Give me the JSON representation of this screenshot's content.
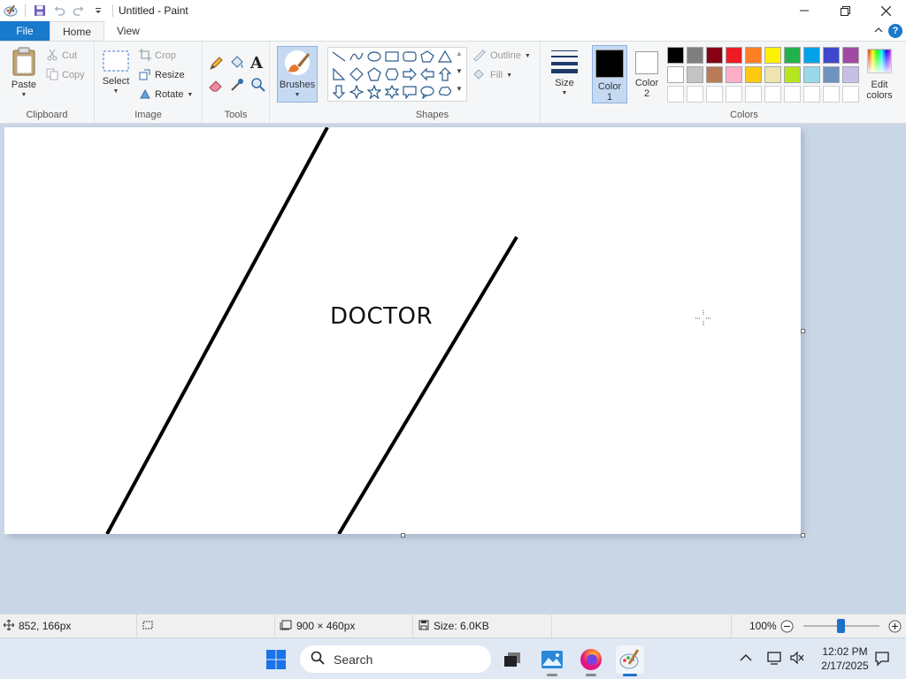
{
  "window": {
    "title": "Untitled - Paint"
  },
  "tabs": {
    "file": "File",
    "home": "Home",
    "view": "View"
  },
  "clipboard": {
    "paste": "Paste",
    "cut": "Cut",
    "copy": "Copy",
    "label": "Clipboard"
  },
  "image": {
    "select": "Select",
    "crop": "Crop",
    "resize": "Resize",
    "rotate": "Rotate",
    "label": "Image"
  },
  "tools": {
    "label": "Tools",
    "text_glyph": "A"
  },
  "brushes": {
    "label": "Brushes"
  },
  "shapes": {
    "outline": "Outline",
    "fill": "Fill",
    "label": "Shapes"
  },
  "size": {
    "label": "Size"
  },
  "colors": {
    "color1_line1": "Color",
    "color1_line2": "1",
    "color2_line1": "Color",
    "color2_line2": "2",
    "edit_line1": "Edit",
    "edit_line2": "colors",
    "label": "Colors",
    "color1_value": "#000000",
    "color2_value": "#ffffff",
    "row1": [
      "#000000",
      "#7f7f7f",
      "#880015",
      "#ed1c24",
      "#ff7f27",
      "#fff200",
      "#22b14c",
      "#00a2e8",
      "#3f48cc",
      "#a349a4"
    ],
    "row2": [
      "#ffffff",
      "#c3c3c3",
      "#b97a57",
      "#ffaec9",
      "#ffc90e",
      "#efe4b0",
      "#b5e61d",
      "#99d9ea",
      "#7092be",
      "#c8bfe7"
    ],
    "row3_count": 10
  },
  "canvas": {
    "text": "DOCTOR"
  },
  "status": {
    "cursor_pos": "852, 166px",
    "canvas_size": "900 × 460px",
    "file_size": "Size: 6.0KB",
    "zoom": "100%"
  },
  "taskbar": {
    "search_placeholder": "Search",
    "time": "12:02 PM",
    "date": "2/17/2025"
  },
  "icons": [
    "paint-app-icon",
    "save-icon",
    "undo-icon",
    "redo-icon",
    "customize-qat-icon",
    "minimize-icon",
    "maximize-icon",
    "close-icon",
    "collapse-ribbon-icon",
    "help-icon",
    "paste-icon",
    "cut-icon",
    "copy-icon",
    "select-icon",
    "crop-icon",
    "resize-icon",
    "rotate-icon",
    "pencil-icon",
    "fill-icon",
    "text-icon",
    "eraser-icon",
    "color-picker-icon",
    "magnifier-icon",
    "brush-icon",
    "outline-icon",
    "shape-fill-icon",
    "size-icon",
    "edit-colors-icon",
    "cursor-position-icon",
    "selection-size-icon",
    "canvas-size-icon",
    "file-size-icon",
    "zoom-out-icon",
    "zoom-in-icon",
    "windows-start-icon",
    "search-icon",
    "task-view-icon",
    "gallery-app-icon",
    "firefox-icon",
    "paint-taskbar-icon",
    "tray-chevron-icon",
    "network-icon",
    "volume-muted-icon",
    "notification-icon"
  ]
}
